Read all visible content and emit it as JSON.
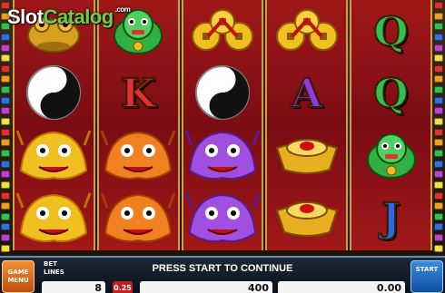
{
  "watermark": {
    "text_a": "Slot",
    "text_b": "Catalog",
    "suffix": ".com"
  },
  "reels": [
    [
      {
        "symbol": "toad-icon"
      },
      {
        "symbol": "yinyang-icon"
      },
      {
        "symbol": "yellow-dragon-icon"
      },
      {
        "symbol": "yellow-dragon-icon"
      }
    ],
    [
      {
        "symbol": "green-lion-icon"
      },
      {
        "symbol": "letter-k",
        "label": "K",
        "color": "#e03030"
      },
      {
        "symbol": "orange-dragon-icon"
      },
      {
        "symbol": "orange-dragon-icon"
      }
    ],
    [
      {
        "symbol": "coins-icon"
      },
      {
        "symbol": "yinyang-icon"
      },
      {
        "symbol": "purple-dragon-icon"
      },
      {
        "symbol": "purple-dragon-icon"
      }
    ],
    [
      {
        "symbol": "coins-icon"
      },
      {
        "symbol": "letter-a",
        "label": "A",
        "color": "#8a3ae0"
      },
      {
        "symbol": "gold-ingot-icon"
      },
      {
        "symbol": "gold-ingot-icon"
      }
    ],
    [
      {
        "symbol": "letter-q",
        "label": "Q",
        "color": "#30c050"
      },
      {
        "symbol": "letter-q",
        "label": "Q",
        "color": "#30c050"
      },
      {
        "symbol": "green-lion-icon"
      },
      {
        "symbol": "letter-j",
        "label": "J",
        "color": "#2a6ae0"
      }
    ]
  ],
  "controls": {
    "game_menu_line1": "GAME",
    "game_menu_line2": "MENU",
    "bet_label": "BET",
    "lines_label": "LINES",
    "status": "PRESS START TO CONTINUE",
    "start_label": "START",
    "lines_value": "8",
    "bet_value": "0.25",
    "total_value": "400",
    "win_value": "0.00"
  }
}
